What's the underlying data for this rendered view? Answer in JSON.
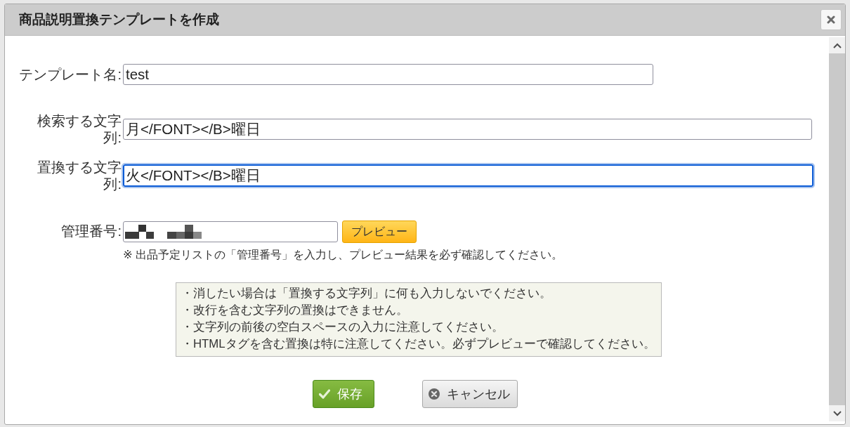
{
  "dialog": {
    "title": "商品説明置換テンプレートを作成"
  },
  "form": {
    "fields": [
      {
        "kind": "name",
        "label": "テンプレート名:",
        "value": "test",
        "focused": false
      },
      {
        "kind": "pattern",
        "label": "検索する文字列:",
        "value": "月</FONT></B>曜日",
        "focused": false
      },
      {
        "kind": "pattern",
        "label": "置換する文字列:",
        "value": "火</FONT></B>曜日",
        "focused": true
      },
      {
        "kind": "lookup",
        "label": "管理番号:",
        "value_masked": true,
        "focused": false,
        "button": "プレビュー",
        "note": "※ 出品予定リストの「管理番号」を入力し、プレビュー結果を必ず確認してください。"
      }
    ]
  },
  "notice": {
    "lines": [
      "・消したい場合は「置換する文字列」に何も入力しないでください。",
      "・改行を含む文字列の置換はできません。",
      "・文字列の前後の空白スペースの入力に注意してください。",
      "・HTMLタグを含む置換は特に注意してください。必ずプレビューで確認してください。"
    ]
  },
  "buttons": [
    {
      "kind": "primary",
      "label": "保存"
    },
    {
      "kind": "secondary",
      "label": "キャンセル"
    }
  ]
}
